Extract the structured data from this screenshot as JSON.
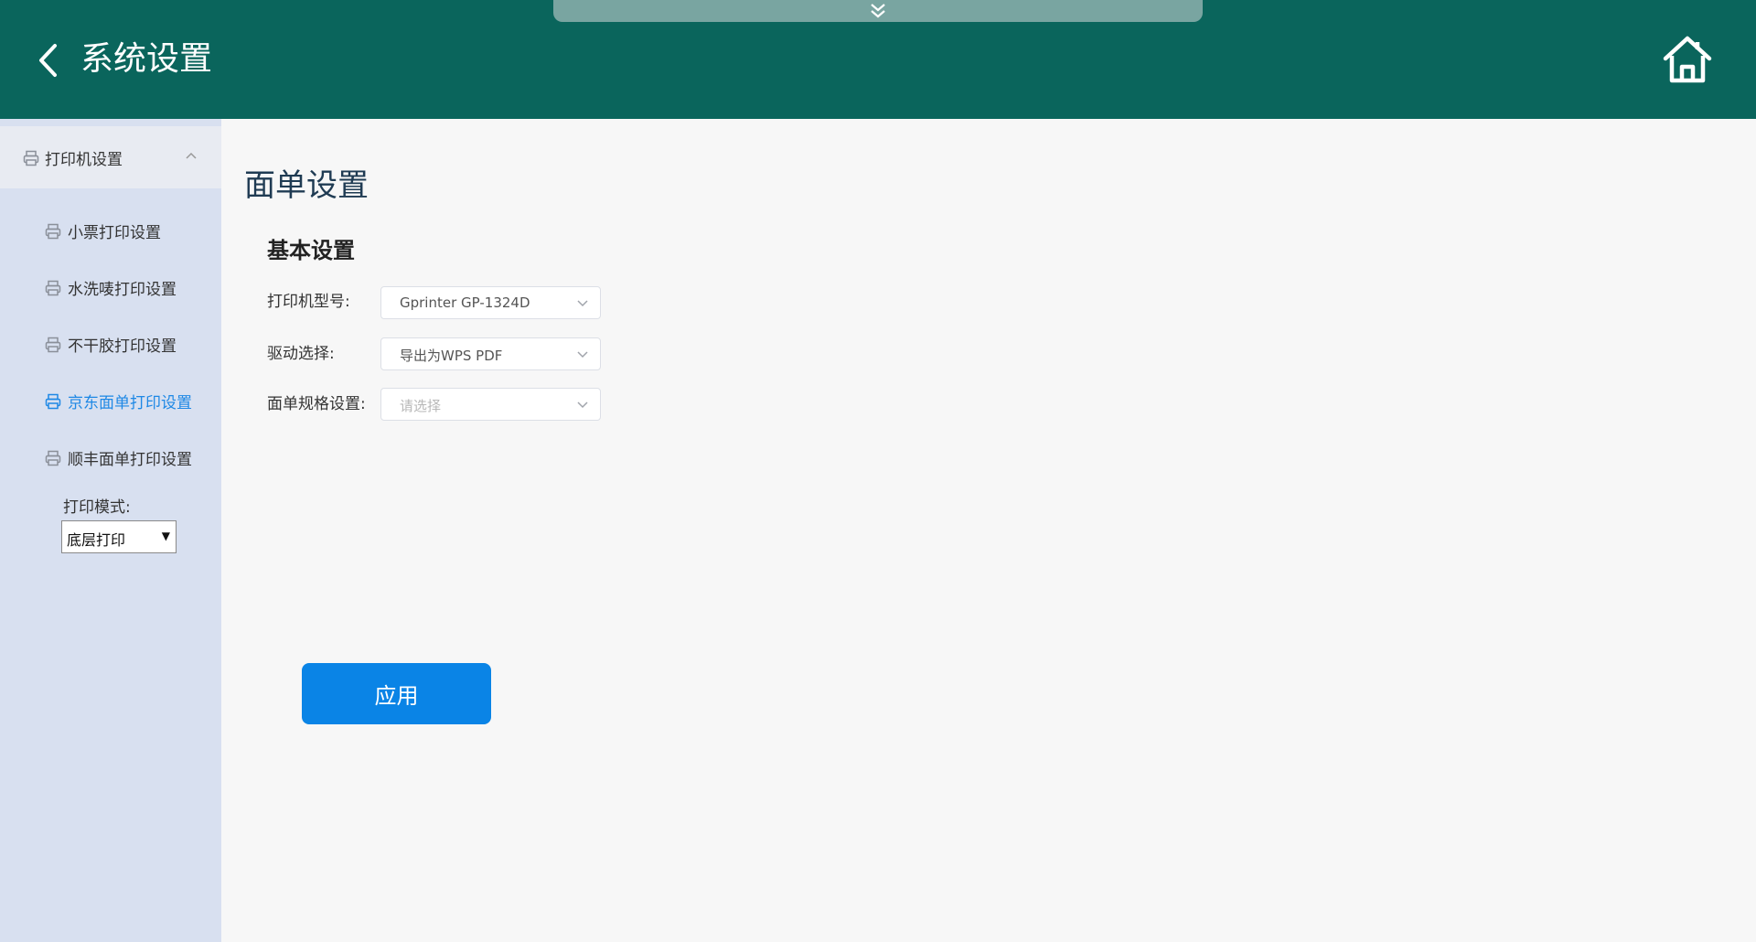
{
  "header": {
    "title": "系统设置",
    "back_icon": "chevron-left-icon",
    "home_icon": "home-icon",
    "pull_tab_icon": "double-chevron-down-icon"
  },
  "sidebar": {
    "group": {
      "label": "打印机设置",
      "icon": "printer-icon",
      "expanded": true
    },
    "items": [
      {
        "label": "小票打印设置",
        "icon": "printer-icon",
        "active": false
      },
      {
        "label": "水洗唛打印设置",
        "icon": "printer-icon",
        "active": false
      },
      {
        "label": "不干胶打印设置",
        "icon": "printer-icon",
        "active": false
      },
      {
        "label": "京东面单打印设置",
        "icon": "printer-icon",
        "active": true
      },
      {
        "label": "顺丰面单打印设置",
        "icon": "printer-icon",
        "active": false
      }
    ],
    "print_mode": {
      "label": "打印模式:",
      "value": "底层打印"
    }
  },
  "main": {
    "title": "面单设置",
    "section_title": "基本设置",
    "fields": [
      {
        "label": "打印机型号:",
        "value": "Gprinter GP-1324D",
        "placeholder": false
      },
      {
        "label": "驱动选择:",
        "value": "导出为WPS PDF",
        "placeholder": false
      },
      {
        "label": "面单规格设置:",
        "value": "请选择",
        "placeholder": true
      }
    ],
    "apply_label": "应用"
  },
  "colors": {
    "header_bg": "#0a655c",
    "sidebar_bg": "#d8e0f0",
    "active_item": "#1e88e5",
    "primary_button": "#0a84e6"
  }
}
